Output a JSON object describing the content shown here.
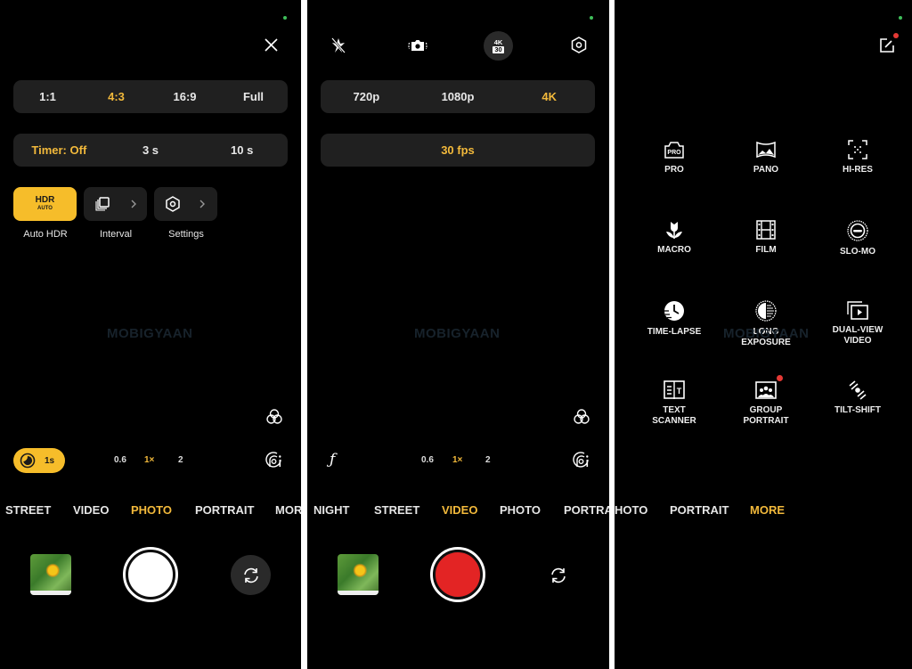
{
  "photo_settings": {
    "close_icon": "close-icon",
    "aspect_ratios": [
      {
        "label": "1:1",
        "active": false
      },
      {
        "label": "4:3",
        "active": true
      },
      {
        "label": "16:9",
        "active": false
      },
      {
        "label": "Full",
        "active": false
      }
    ],
    "timer_options": [
      {
        "label": "Timer: Off",
        "active": true
      },
      {
        "label": "3 s",
        "active": false
      },
      {
        "label": "10 s",
        "active": false
      }
    ],
    "tiles": {
      "hdr_title": "HDR",
      "hdr_sub": "AUTO",
      "hdr_label": "Auto HDR",
      "interval_label": "Interval",
      "settings_label": "Settings"
    },
    "watermark": "MOBIGYAAN",
    "exposure_badge": "1s",
    "zoom_levels": [
      {
        "label": "0.6",
        "active": false
      },
      {
        "label": "1×",
        "active": true
      },
      {
        "label": "2",
        "active": false
      }
    ],
    "modes": [
      "STREET",
      "VIDEO",
      "PHOTO",
      "PORTRAIT",
      "MOR"
    ],
    "active_mode": "PHOTO"
  },
  "video_settings": {
    "top_icons": [
      "flash-off-icon",
      "stabilization-icon",
      "resolution-4k30-icon",
      "settings-icon"
    ],
    "res_badge_top": "4K",
    "res_badge_bottom": "30",
    "resolutions": [
      {
        "label": "720p",
        "active": false
      },
      {
        "label": "1080p",
        "active": false
      },
      {
        "label": "4K",
        "active": true
      }
    ],
    "fps": "30 fps",
    "watermark": "MOBIGYAAN",
    "filter_glyph": "ƒ",
    "zoom_levels": [
      {
        "label": "0.6",
        "active": false
      },
      {
        "label": "1×",
        "active": true
      },
      {
        "label": "2",
        "active": false
      }
    ],
    "modes": [
      "NIGHT",
      "STREET",
      "VIDEO",
      "PHOTO",
      "PORTRA"
    ],
    "active_mode": "VIDEO"
  },
  "more_modes": {
    "edit_icon": "edit-icon",
    "items": [
      {
        "label": "PRO",
        "icon": "pro-icon"
      },
      {
        "label": "PANO",
        "icon": "pano-icon"
      },
      {
        "label": "HI-RES",
        "icon": "hi-res-icon"
      },
      {
        "label": "MACRO",
        "icon": "macro-icon"
      },
      {
        "label": "FILM",
        "icon": "film-icon"
      },
      {
        "label": "SLO-MO",
        "icon": "slo-mo-icon"
      },
      {
        "label": "TIME-LAPSE",
        "icon": "time-lapse-icon"
      },
      {
        "label": "LONG\nEXPOSURE",
        "icon": "long-exposure-icon"
      },
      {
        "label": "DUAL-VIEW\nVIDEO",
        "icon": "dual-view-video-icon"
      },
      {
        "label": "TEXT\nSCANNER",
        "icon": "text-scanner-icon"
      },
      {
        "label": "GROUP\nPORTRAIT",
        "icon": "group-portrait-icon",
        "new_badge": true
      },
      {
        "label": "TILT-SHIFT",
        "icon": "tilt-shift-icon"
      }
    ],
    "watermark": "MOBIGYAAN",
    "modes": [
      "HOTO",
      "PORTRAIT",
      "MORE"
    ],
    "active_mode": "MORE"
  },
  "colors": {
    "accent": "#f2b93b",
    "record": "#e32424",
    "pill_bg": "#202020",
    "badge_red": "#e53935"
  }
}
